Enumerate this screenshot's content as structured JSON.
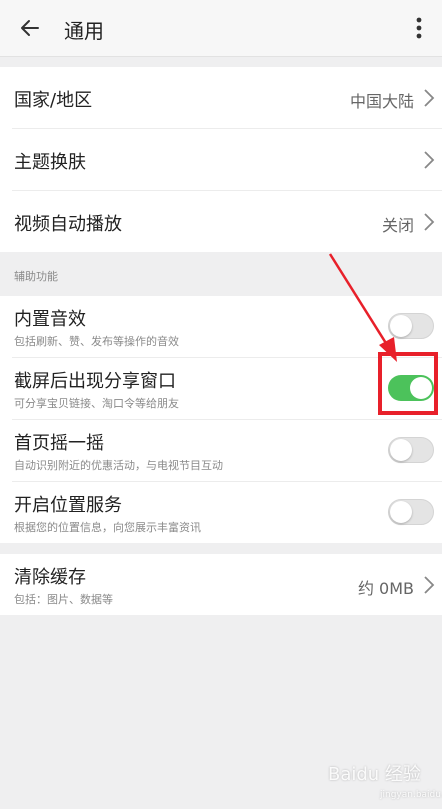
{
  "header": {
    "title": "通用",
    "back_icon": "back-arrow-icon",
    "more_icon": "more-vertical-icon"
  },
  "group_region": [
    {
      "label": "国家/地区",
      "value": "中国大陆"
    },
    {
      "label": "主题换肤",
      "value": ""
    },
    {
      "label": "视频自动播放",
      "value": "关闭"
    }
  ],
  "section_assist": {
    "label": "辅助功能"
  },
  "toggles": [
    {
      "label": "内置音效",
      "desc": "包括刷新、赞、发布等操作的音效",
      "on": false
    },
    {
      "label": "截屏后出现分享窗口",
      "desc": "可分享宝贝链接、淘口令等给朋友",
      "on": true
    },
    {
      "label": "首页摇一摇",
      "desc": "自动识别附近的优惠活动，与电视节目互动",
      "on": false
    },
    {
      "label": "开启位置服务",
      "desc": "根据您的位置信息，向您展示丰富资讯",
      "on": false
    }
  ],
  "cache": {
    "label": "清除缓存",
    "desc": "包括：图片、数据等",
    "value": "约 0MB"
  },
  "watermark": {
    "text": "Baidu 经验",
    "sub": "jingyan.baidu.com"
  },
  "colors": {
    "toggle_on": "#4cc25b",
    "highlight": "#e8202a",
    "background": "#efeff0"
  }
}
